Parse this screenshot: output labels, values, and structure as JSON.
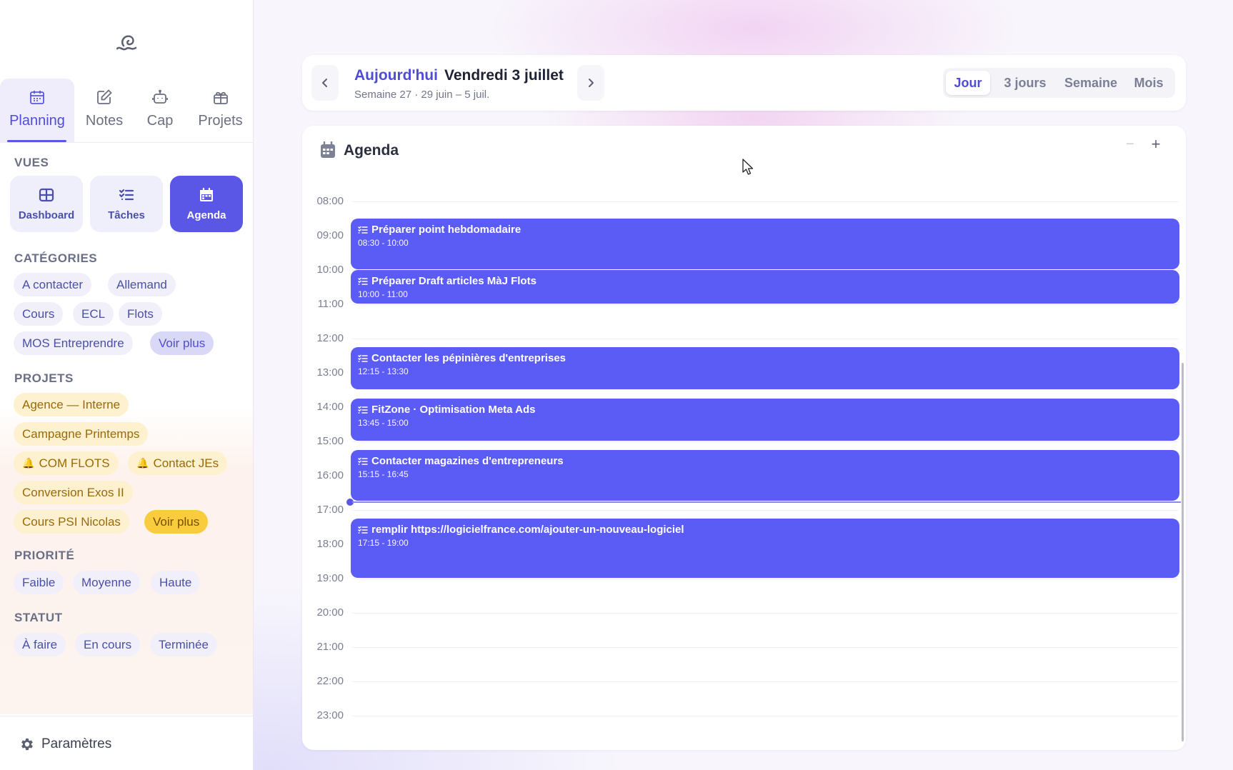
{
  "nav_tabs": [
    {
      "label": "Planning",
      "icon": "calendar-icon",
      "active": true
    },
    {
      "label": "Notes",
      "icon": "edit-icon",
      "active": false
    },
    {
      "label": "Cap",
      "icon": "robot-icon",
      "active": false
    },
    {
      "label": "Projets",
      "icon": "gift-icon",
      "active": false
    }
  ],
  "sidebar": {
    "views_title": "VUES",
    "views": [
      {
        "label": "Dashboard",
        "icon": "grid-icon",
        "active": false
      },
      {
        "label": "Tâches",
        "icon": "tasklist-icon",
        "active": false
      },
      {
        "label": "Agenda",
        "icon": "calendar-icon",
        "active": true
      }
    ],
    "categories_title": "CATÉGORIES",
    "categories": [
      "A contacter",
      "Allemand",
      "Cours",
      "ECL",
      "Flots",
      "MOS Entreprendre"
    ],
    "categories_more": "Voir plus",
    "projects_title": "PROJETS",
    "projects": [
      "Agence — Interne",
      "Campagne Printemps",
      "COM FLOTS",
      "Contact JEs",
      "Conversion Exos II",
      "Cours PSI Nicolas"
    ],
    "projects_more": "Voir plus",
    "priority_title": "PRIORITÉ",
    "priorities": [
      "Faible",
      "Moyenne",
      "Haute"
    ],
    "status_title": "STATUT",
    "statuses": [
      "À faire",
      "En cours",
      "Terminée"
    ],
    "settings_label": "Paramètres"
  },
  "header": {
    "today_label": "Aujourd'hui",
    "date": "Vendredi 3 juillet",
    "week_info": "Semaine 27 · 29 juin – 5 juil.",
    "view_modes": [
      "Jour",
      "3 jours",
      "Semaine",
      "Mois"
    ],
    "active_mode": "Jour"
  },
  "agenda": {
    "title": "Agenda",
    "zoom_out": "−",
    "zoom_in": "+",
    "hours": [
      "08:00",
      "09:00",
      "10:00",
      "11:00",
      "12:00",
      "13:00",
      "14:00",
      "15:00",
      "16:00",
      "17:00",
      "18:00",
      "19:00",
      "20:00",
      "21:00",
      "22:00",
      "23:00"
    ],
    "events": [
      {
        "title": "Préparer point hebdomadaire",
        "time": "08:30 - 10:00"
      },
      {
        "title": "Préparer Draft articles MàJ Flots",
        "time": "10:00 - 11:00"
      },
      {
        "title": "Contacter les pépinières d'entreprises",
        "time": "12:15 - 13:30"
      },
      {
        "title": "FitZone · Optimisation Meta Ads",
        "time": "13:45 - 15:00"
      },
      {
        "title": "Contacter magazines d'entrepreneurs",
        "time": "15:15 - 16:45"
      },
      {
        "title": "remplir https://logicielfrance.com/ajouter-un-nouveau-logiciel",
        "time": "17:15 - 19:00"
      }
    ],
    "event_color": "#5b5cf6",
    "current_time_indicator_color": "#5a57e6"
  },
  "colors": {
    "accent": "#5a57e6",
    "project_chip": "#fdf1cf",
    "project_more": "#f8cc3c"
  }
}
